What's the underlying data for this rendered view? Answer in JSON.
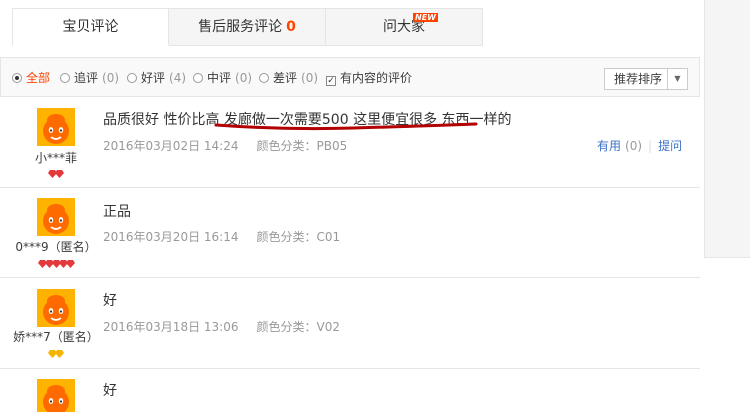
{
  "tabs": [
    {
      "label": "宝贝评论"
    },
    {
      "label": "售后服务评论",
      "count": "0"
    },
    {
      "label": "问大家",
      "badge": "NEW"
    }
  ],
  "filters": {
    "all": {
      "label": "全部"
    },
    "append": {
      "label": "追评",
      "count": "(0)"
    },
    "good": {
      "label": "好评",
      "count": "(4)"
    },
    "neutral": {
      "label": "中评",
      "count": "(0)"
    },
    "bad": {
      "label": "差评",
      "count": "(0)"
    },
    "with_content": {
      "label": "有内容的评价",
      "checked": true
    }
  },
  "sort": {
    "label": "推荐排序"
  },
  "reviews": [
    {
      "user": "小***菲",
      "rank_gems": 2,
      "rank_color": "red",
      "content": "品质很好 性价比高 发廊做一次需要500 这里便宜很多 东西一样的",
      "date": "2016年03月02日 14:24",
      "variant": "颜色分类：PB05",
      "useful_label": "有用",
      "useful_count": "(0)",
      "reply_label": "提问"
    },
    {
      "user": "0***9（匿名）",
      "rank_gems": 5,
      "rank_color": "red",
      "content": "正品",
      "date": "2016年03月20日 16:14",
      "variant": "颜色分类：C01"
    },
    {
      "user": "娇***7（匿名）",
      "rank_gems": 2,
      "rank_color": "yellow",
      "content": "好",
      "date": "2016年03月18日 13:06",
      "variant": "颜色分类：V02"
    },
    {
      "content": "好"
    }
  ],
  "colors": {
    "accent": "#ff4400",
    "link": "#3c72c6",
    "annotation": "#b30000"
  }
}
